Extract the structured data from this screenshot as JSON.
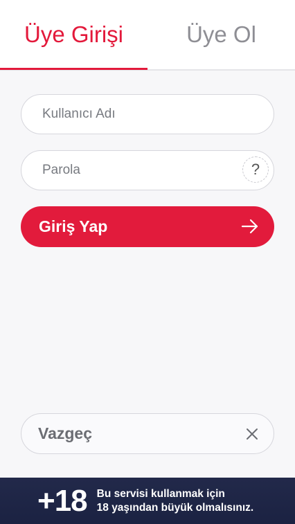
{
  "tabs": [
    {
      "label": "Üye Girişi",
      "active": true
    },
    {
      "label": "Üye Ol",
      "active": false
    }
  ],
  "form": {
    "username_placeholder": "Kullanıcı Adı",
    "password_placeholder": "Parola",
    "help_label": "?",
    "login_label": "Giriş Yap",
    "cancel_label": "Vazgeç"
  },
  "banner": {
    "age": "+18",
    "line1": "Bu servisi kullanmak için",
    "line2": "18 yaşından büyük olmalısınız."
  },
  "colors": {
    "accent": "#e21b3c",
    "banner_bg": "#1f2546"
  },
  "icons": {
    "login_button": "arrow-right-icon",
    "cancel_button": "close-icon",
    "password_help": "question-icon"
  }
}
